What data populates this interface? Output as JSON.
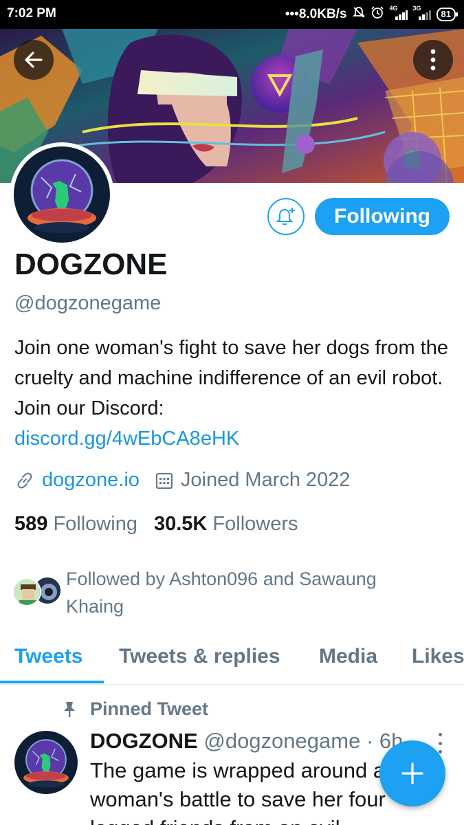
{
  "status_bar": {
    "time": "7:02 PM",
    "net_speed": "8.0KB/s",
    "sig1_label": "4G",
    "sig2_label": "3G",
    "battery": "81"
  },
  "icons": {
    "back": "arrow-left-icon",
    "more": "more-vertical-icon",
    "bell": "bell-plus-icon",
    "link": "link-icon",
    "calendar": "calendar-icon",
    "pin": "pin-icon",
    "compose": "plus-icon"
  },
  "colors": {
    "accent": "#1da1f2",
    "link": "#1b95e0",
    "muted": "#657786",
    "text": "#14171a"
  },
  "profile": {
    "follow_button": "Following",
    "display_name": "DOGZONE",
    "handle": "@dogzonegame",
    "bio_text": "Join one woman's fight to save her dogs from the cruelty and machine indifference of an evil robot.  Join our Discord:",
    "bio_link": "discord.gg/4wEbCA8eHK",
    "website": "dogzone.io",
    "joined": "Joined March 2022",
    "following_count": "589",
    "following_label": "Following",
    "followers_count": "30.5K",
    "followers_label": "Followers",
    "followed_by": "Followed by Ashton096 and Sawaung Khaing"
  },
  "tabs": [
    {
      "label": "Tweets",
      "active": true
    },
    {
      "label": "Tweets & replies",
      "active": false
    },
    {
      "label": "Media",
      "active": false
    },
    {
      "label": "Likes",
      "active": false
    }
  ],
  "pinned_tweet": {
    "pinned_label": "Pinned Tweet",
    "name": "DOGZONE",
    "handle": "@dogzonegame",
    "time": "· 6h",
    "text_lines": [
      "The game is wrapped around a",
      "woman's battle to save her four",
      "legged friends from an evil"
    ]
  }
}
